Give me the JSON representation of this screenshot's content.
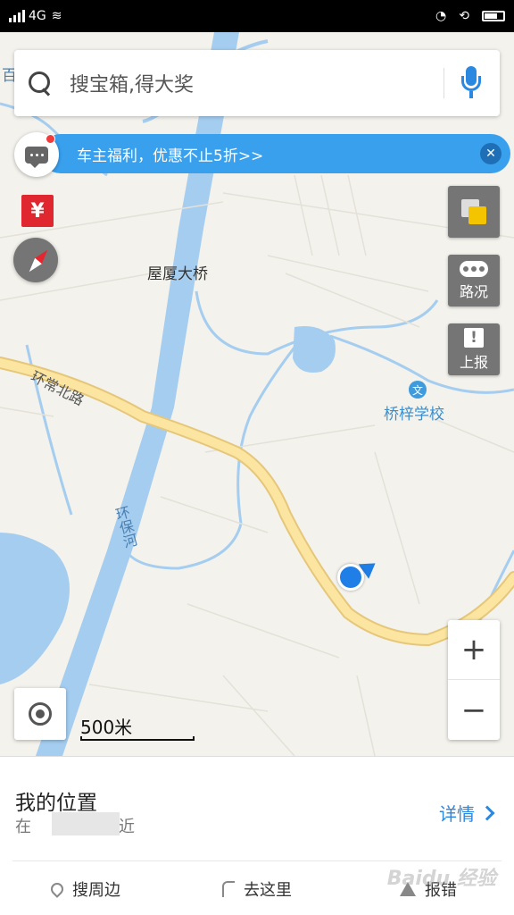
{
  "status_bar": {
    "network": "4G"
  },
  "search": {
    "placeholder": "搜宝箱,得大奖"
  },
  "promo": {
    "text": "车主福利，优惠不止5折>>"
  },
  "map": {
    "labels": {
      "bridge": "屋厦大桥",
      "road": "环常北路",
      "river": "环保河",
      "school": "桥梓学校",
      "school_icon_text": "文",
      "corner_fragment": "百"
    },
    "scale": "500米",
    "colors": {
      "water": "#a5cdf0",
      "road": "#fbe5a0",
      "road_outline": "#e6c77a",
      "land": "#f3f2ec",
      "accent": "#2b88e0"
    }
  },
  "side_buttons": {
    "traffic": "路况",
    "report": "上报"
  },
  "red_packet": "¥",
  "zoom": {
    "in": "+",
    "out": "−"
  },
  "bottom": {
    "title": "我的位置",
    "subtitle": "在",
    "subtitle_suffix": "附近",
    "details": "详情",
    "actions": {
      "nearby": "搜周边",
      "go_here": "去这里",
      "report_error": "报错"
    },
    "watermark": "Baidu 经验"
  }
}
